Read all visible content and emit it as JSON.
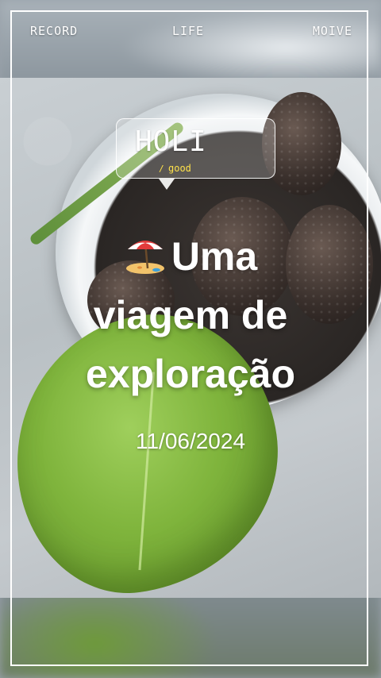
{
  "header": {
    "left": "RECORD",
    "center": "LIFE",
    "right": "MOIVE"
  },
  "bubble": {
    "title": "HOLI",
    "slash": "/",
    "subtitle": "good"
  },
  "title": {
    "line1": "Uma",
    "line2": "viagem de",
    "line3": "exploração",
    "icon": "beach-umbrella-icon"
  },
  "date": "11/06/2024",
  "colors": {
    "accent": "#ffe24a",
    "text": "#ffffff"
  }
}
